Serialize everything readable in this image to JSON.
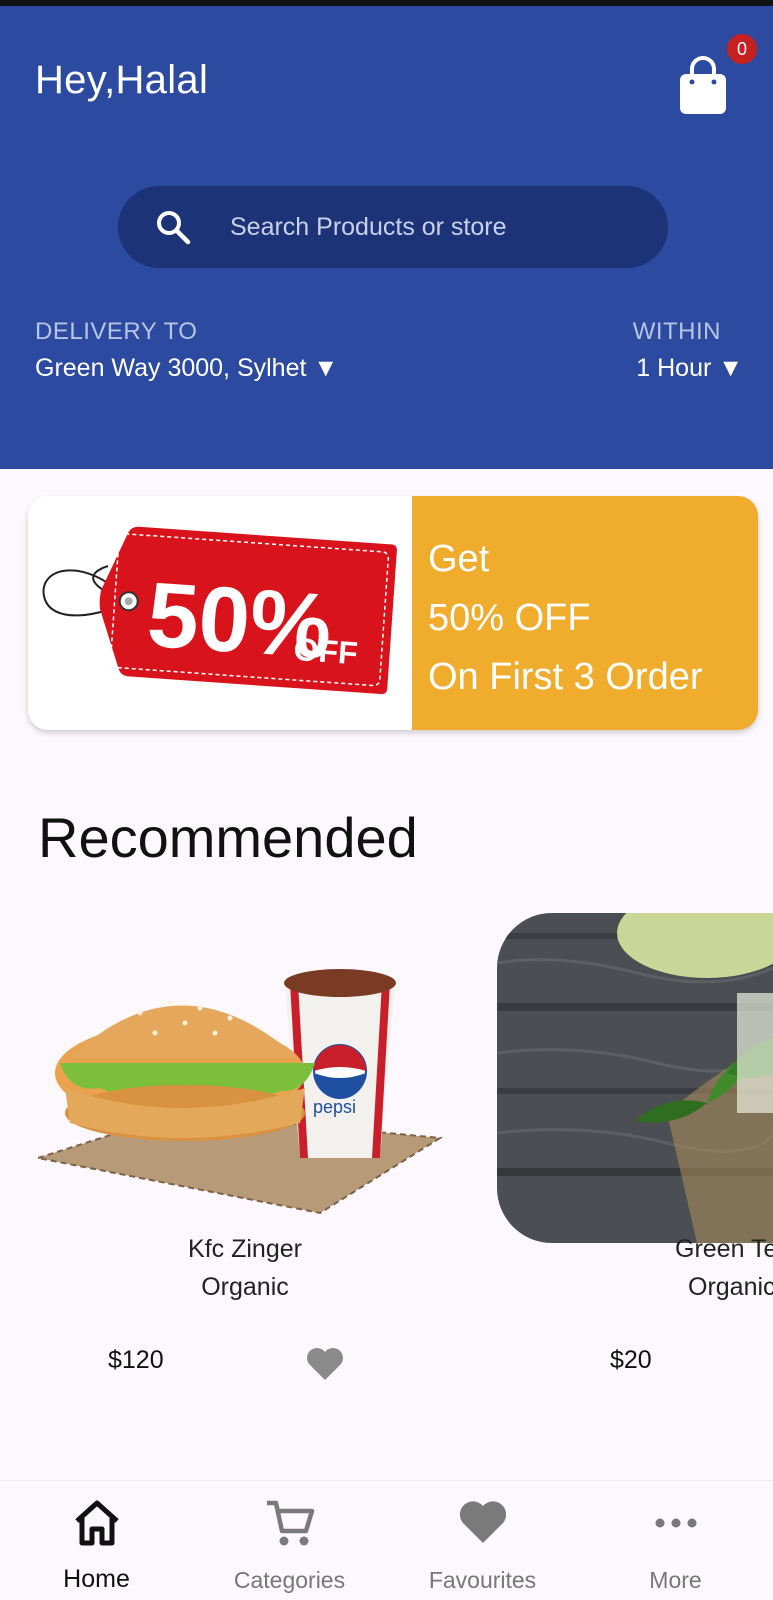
{
  "header": {
    "greeting": "Hey,Halal",
    "cart_count": "0",
    "search_placeholder": "Search Products or store",
    "delivery_label": "DELIVERY TO",
    "delivery_value": "Green Way 3000, Sylhet ▼",
    "within_label": "WITHIN",
    "within_value": "1 Hour ▼"
  },
  "banner": {
    "tag_text": "50%",
    "tag_off": "OFF",
    "lines": [
      "Get",
      "50% OFF",
      "On First 3 Order"
    ]
  },
  "recommended": {
    "title": "Recommended",
    "items": [
      {
        "name": "Kfc Zinger",
        "tag": "Organic",
        "price": "$120"
      },
      {
        "name": "Green Tea",
        "tag": "Organic",
        "price": "$20"
      }
    ]
  },
  "nav": {
    "items": [
      {
        "label": "Home",
        "icon": "home-icon"
      },
      {
        "label": "Categories",
        "icon": "cart-icon"
      },
      {
        "label": "Favourites",
        "icon": "heart-icon"
      },
      {
        "label": "More",
        "icon": "more-icon"
      }
    ]
  },
  "colors": {
    "header_blue": "#2c4a9f",
    "search_blue": "#1c3378",
    "banner_orange": "#f0ac2c",
    "badge_red": "#c62020"
  }
}
